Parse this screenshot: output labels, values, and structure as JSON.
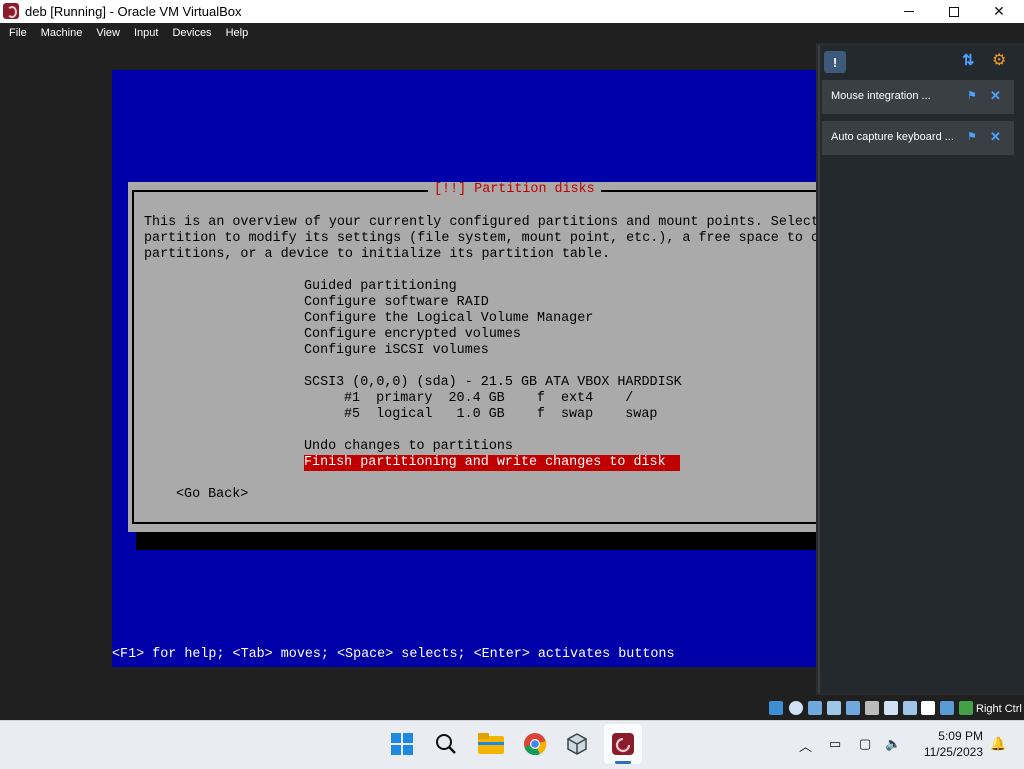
{
  "window": {
    "title": "deb [Running] - Oracle VM VirtualBox",
    "controls": {
      "minimize": "minimize",
      "maximize": "maximize",
      "close": "close"
    }
  },
  "menu": [
    "File",
    "Machine",
    "View",
    "Input",
    "Devices",
    "Help"
  ],
  "installer": {
    "dialog_title": "[!!] Partition disks",
    "intro_lines": [
      "This is an overview of your currently configured partitions and mount points. Select a",
      "partition to modify its settings (file system, mount point, etc.), a free space to create",
      "partitions, or a device to initialize its partition table."
    ],
    "options": [
      "Guided partitioning",
      "Configure software RAID",
      "Configure the Logical Volume Manager",
      "Configure encrypted volumes",
      "Configure iSCSI volumes"
    ],
    "disk": "SCSI3 (0,0,0) (sda) - 21.5 GB ATA VBOX HARDDISK",
    "partitions": [
      "#1  primary  20.4 GB    f  ext4    /",
      "#5  logical   1.0 GB    f  swap    swap"
    ],
    "undo": "Undo changes to partitions",
    "finish": "Finish partitioning and write changes to disk",
    "go_back": "<Go Back>",
    "help_line": "<F1> for help; <Tab> moves; <Space> selects; <Enter> activates buttons"
  },
  "notifications": [
    {
      "text": "Mouse integration ..."
    },
    {
      "text": "Auto capture keyboard ..."
    }
  ],
  "statusbar": {
    "host_key": "Right Ctrl"
  },
  "taskbar": {
    "apps": [
      "windows-start",
      "search",
      "file-explorer",
      "chrome",
      "virtualbox-manager",
      "virtualbox-vm"
    ],
    "time": "5:09 PM",
    "date": "11/25/2023"
  }
}
